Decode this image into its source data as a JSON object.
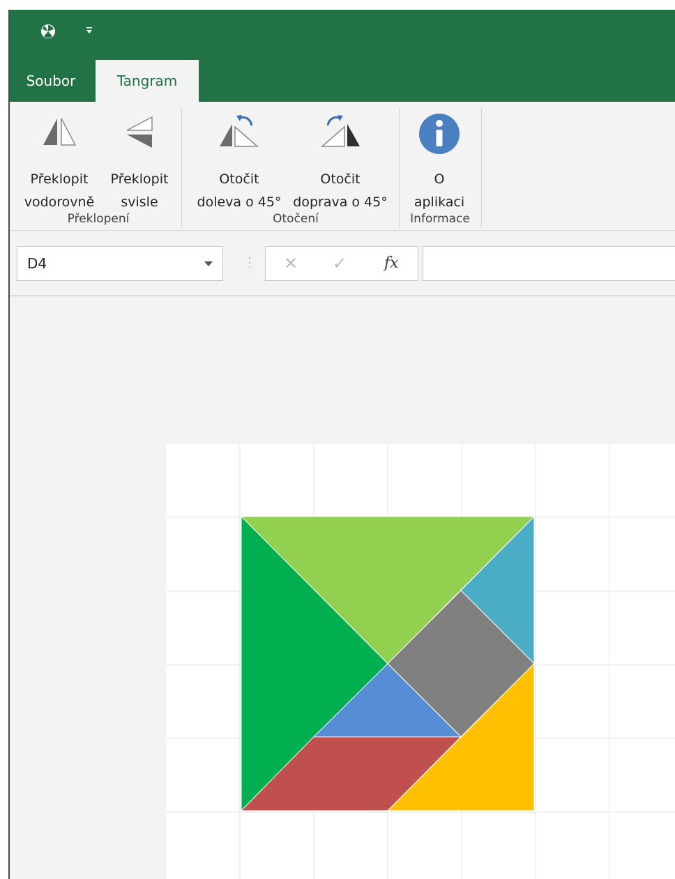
{
  "titlebar": {
    "app_icon": "app-logo-icon",
    "qat_icon": "customize-quick-access-icon"
  },
  "tabs": [
    {
      "label": "Soubor",
      "active": false
    },
    {
      "label": "Tangram",
      "active": true
    }
  ],
  "ribbon": {
    "buttons": [
      {
        "label": "Překlopit\nvodorovně",
        "icon": "flip-horizontal-icon"
      },
      {
        "label": "Překlopit\nsvisle",
        "icon": "flip-vertical-icon"
      },
      {
        "label": "Otočit\ndoleva o 45°",
        "icon": "rotate-left-icon"
      },
      {
        "label": "Otočit\ndoprava o 45°",
        "icon": "rotate-right-icon"
      },
      {
        "label": "O\naplikaci",
        "icon": "info-icon"
      }
    ],
    "groups": [
      {
        "label": "Překlopení"
      },
      {
        "label": "Otočení"
      },
      {
        "label": "Informace"
      }
    ]
  },
  "formula_bar": {
    "name_box": "D4",
    "cancel_icon": "cancel-icon",
    "confirm_icon": "confirm-icon",
    "fx_label": "fx",
    "formula": ""
  },
  "tangram": {
    "colors": {
      "light_green": "#92d050",
      "green": "#00b050",
      "teal": "#4bacc6",
      "gray": "#808080",
      "blue": "#558ed5",
      "red": "#c0504d",
      "yellow": "#ffc000"
    }
  },
  "colors": {
    "titlebar": "#217346",
    "ribbon": "#f3f3f3",
    "info": "#4a7fc1"
  }
}
